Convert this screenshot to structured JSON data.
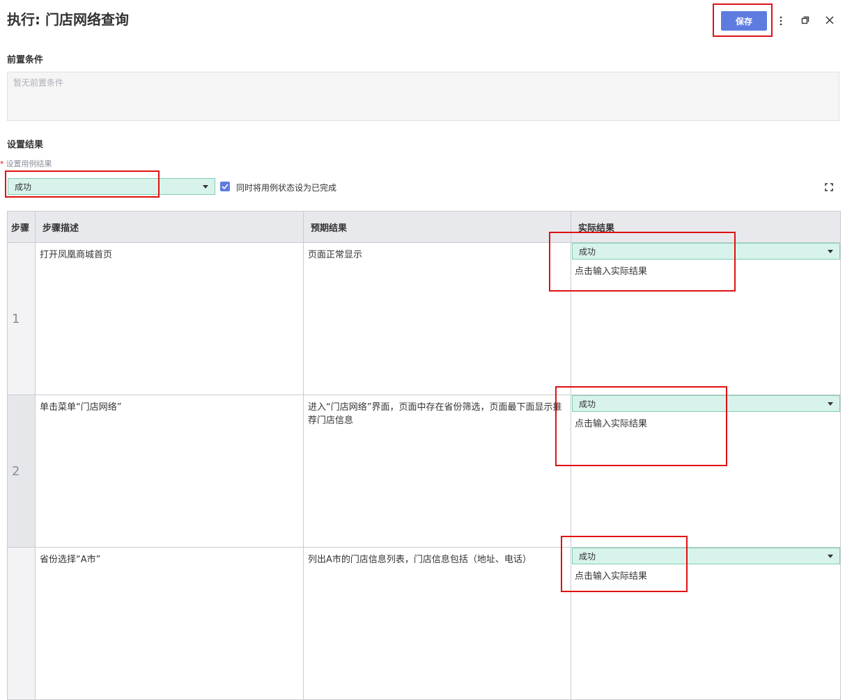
{
  "header": {
    "title": "执行: 门店网络查询",
    "save_label": "保存"
  },
  "precondition": {
    "label": "前置条件",
    "placeholder": "暂无前置条件"
  },
  "result": {
    "section_label": "设置结果",
    "field_label": "设置用例结果",
    "selected": "成功",
    "checkbox_label": "同时将用例状态设为已完成",
    "checkbox_checked": true
  },
  "table": {
    "headers": [
      "步骤",
      "步骤描述",
      "预期结果",
      "实际结果"
    ],
    "rows": [
      {
        "num": "1",
        "desc": "打开凤凰商城首页",
        "expected": "页面正常显示",
        "status": "成功",
        "actual_placeholder": "点击输入实际结果"
      },
      {
        "num": "2",
        "desc": "单击菜单“门店网络”",
        "expected": "进入“门店网络”界面，页面中存在省份筛选，页面最下面显示推荐门店信息",
        "status": "成功",
        "actual_placeholder": "点击输入实际结果"
      },
      {
        "num": "",
        "desc": "省份选择“A市”",
        "expected": "列出A市的门店信息列表，门店信息包括（地址、电话）",
        "status": "成功",
        "actual_placeholder": "点击输入实际结果"
      }
    ]
  },
  "colors": {
    "accent": "#5e7ce0",
    "highlight": "#e01010",
    "select_bg": "#d7f3ec"
  },
  "icons": [
    "more-vertical-icon",
    "restore-window-icon",
    "close-icon",
    "fullscreen-icon",
    "caret-down-icon",
    "check-icon"
  ]
}
